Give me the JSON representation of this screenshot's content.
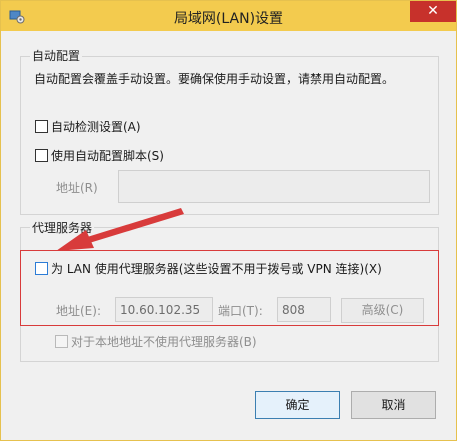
{
  "window": {
    "title": "局域网(LAN)设置",
    "close_label": "✕",
    "app_icon": "network-settings-icon"
  },
  "auto_config": {
    "group_label": "自动配置",
    "description": "自动配置会覆盖手动设置。要确保使用手动设置，请禁用自动配置。",
    "detect_label": "自动检测设置(A)",
    "script_label": "使用自动配置脚本(S)",
    "address_label": "地址(R)",
    "address_value": ""
  },
  "proxy": {
    "group_label": "代理服务器",
    "use_proxy_label": "为 LAN 使用代理服务器(这些设置不用于拨号或 VPN 连接)(X)",
    "address_label": "地址(E):",
    "address_value": "10.60.102.35",
    "port_label": "端口(T):",
    "port_value": "808",
    "advanced_label": "高级(C)",
    "bypass_label": "对于本地地址不使用代理服务器(B)"
  },
  "buttons": {
    "ok": "确定",
    "cancel": "取消"
  },
  "colors": {
    "titlebar": "#f3cb4e",
    "close": "#c7312b",
    "highlight": "#d83b3b"
  }
}
